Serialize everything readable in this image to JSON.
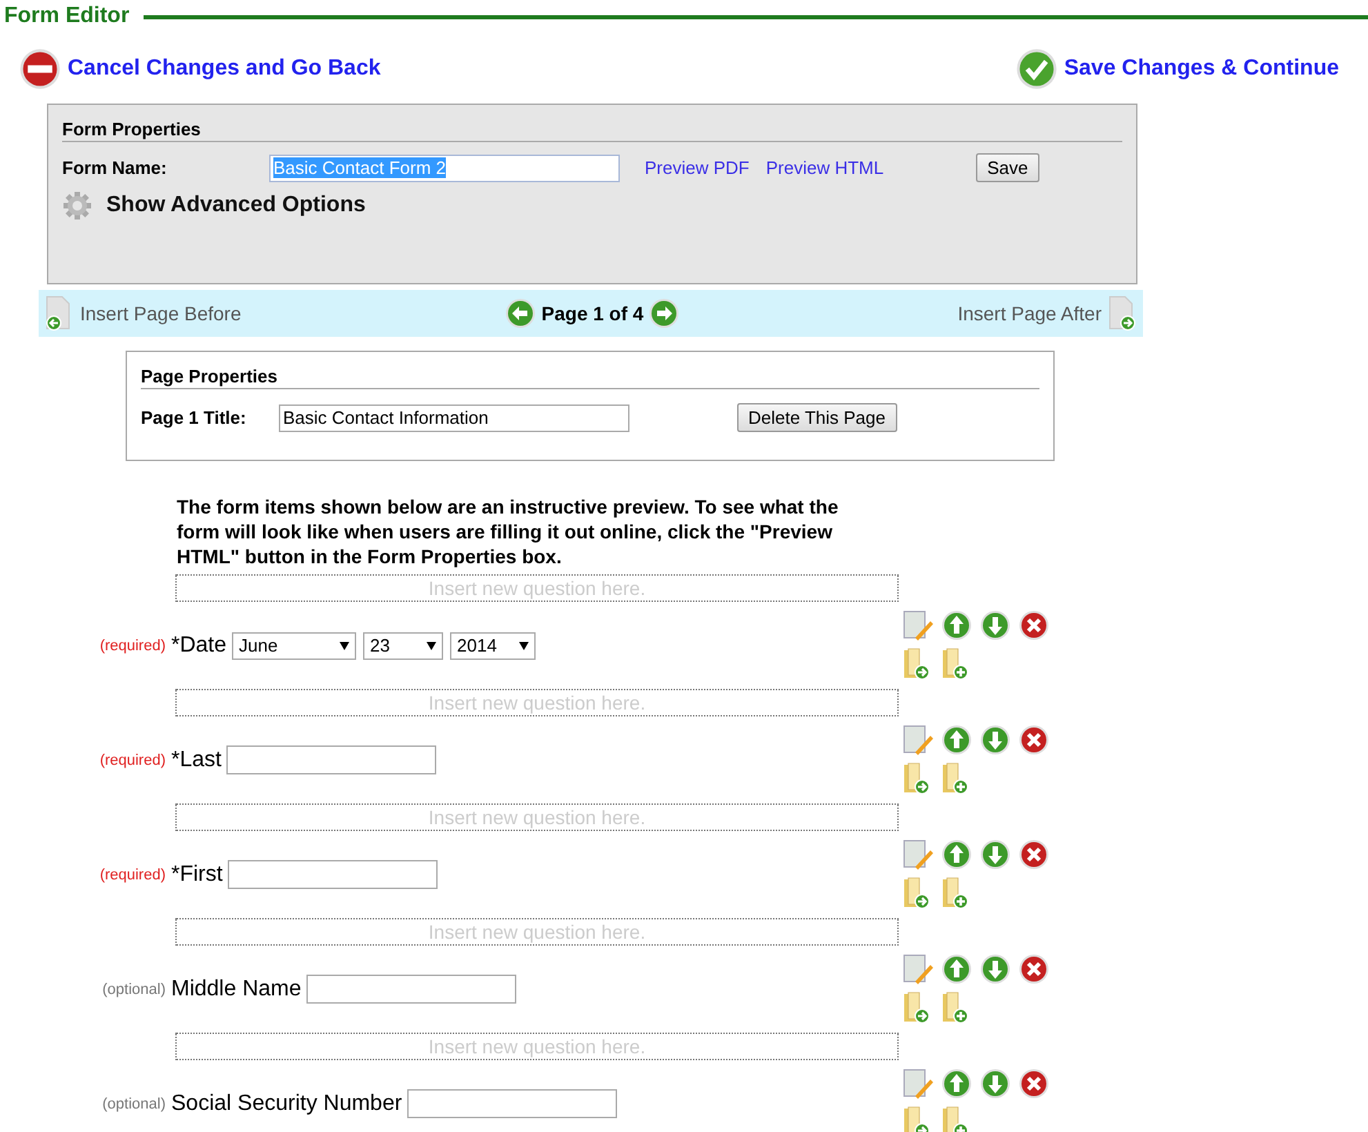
{
  "header": {
    "title": "Form Editor"
  },
  "actions": {
    "cancel": "Cancel Changes and Go Back",
    "save": "Save Changes & Continue"
  },
  "form_properties": {
    "title": "Form Properties",
    "name_label": "Form Name:",
    "name_value": "Basic Contact Form 2",
    "name_text_selected": true,
    "links": [
      "Preview PDF",
      "Preview HTML"
    ],
    "save_button": "Save",
    "advanced": "Show Advanced Options"
  },
  "page_nav": {
    "insert_before": "Insert Page Before",
    "page": "Page 1 of 4",
    "insert_after": "Insert Page After"
  },
  "page_properties": {
    "title": "Page Properties",
    "title_label": "Page 1 Title:",
    "title_value": "Basic Contact Information",
    "delete_button": "Delete This Page"
  },
  "instructions": "The form items shown below are an instructive preview. To see what the form will look like when users are filling it out online, click the \"Preview HTML\" button in the Form Properties box.",
  "questions": [
    {
      "insert_placeholder": "Insert new question here.",
      "requirement": "(required)",
      "required": true,
      "label": "*Date",
      "kind": "date",
      "selects": [
        "June",
        "23",
        "2014"
      ]
    },
    {
      "insert_placeholder": "Insert new question here.",
      "requirement": "(required)",
      "required": true,
      "label": "*Last",
      "kind": "text"
    },
    {
      "insert_placeholder": "Insert new question here.",
      "requirement": "(required)",
      "required": true,
      "label": "*First",
      "kind": "text"
    },
    {
      "insert_placeholder": "Insert new question here.",
      "requirement": "(optional)",
      "required": false,
      "label": "Middle Name",
      "kind": "text"
    },
    {
      "insert_placeholder": "Insert new question here.",
      "requirement": "(optional)",
      "required": false,
      "label": "Social Security Number",
      "kind": "text"
    }
  ]
}
